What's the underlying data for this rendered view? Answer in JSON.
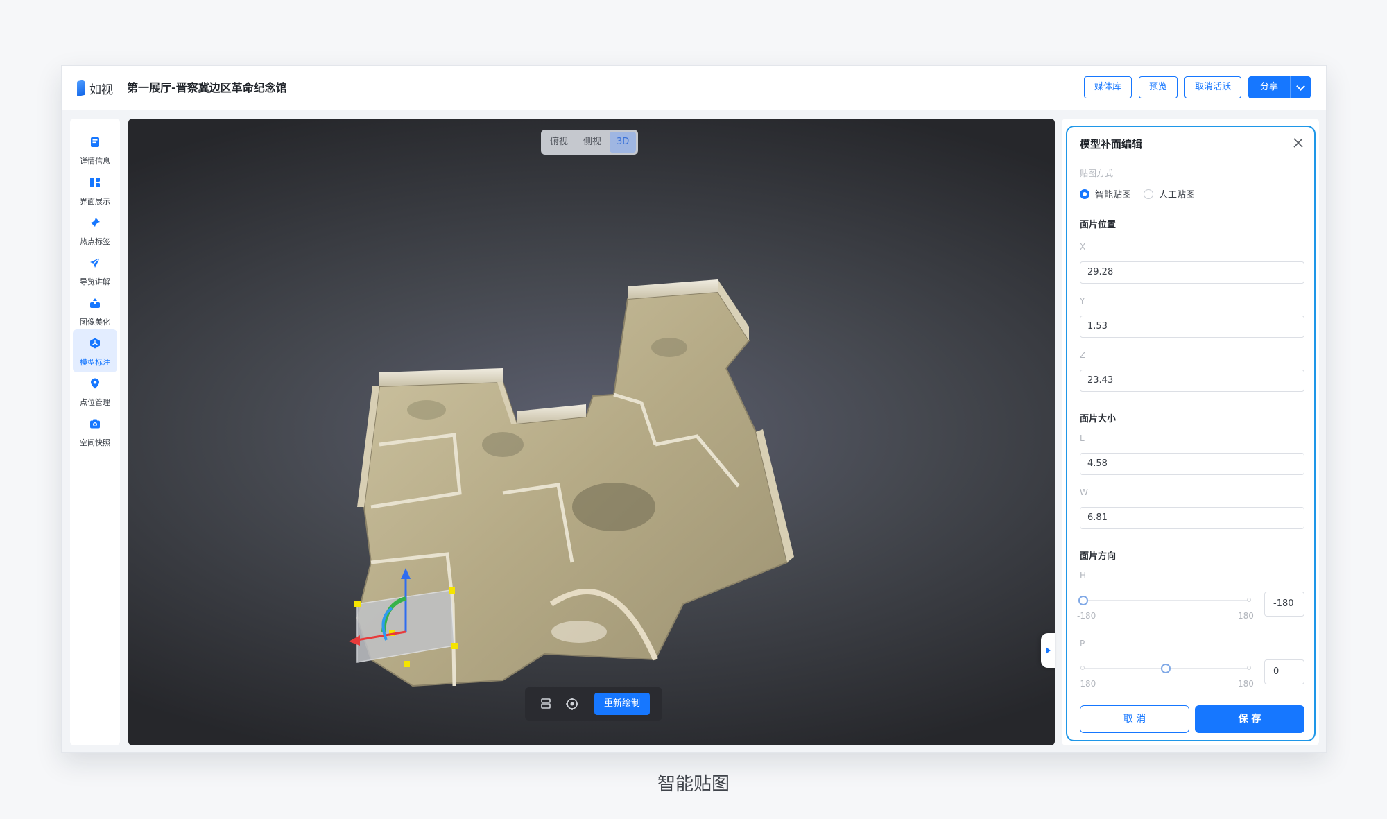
{
  "app": {
    "logo_text": "如视",
    "doc_title": "第一展厅-晋察冀边区革命纪念馆"
  },
  "header": {
    "buttons": [
      "媒体库",
      "预览",
      "取消活跃"
    ],
    "share_label": "分享"
  },
  "sidebar": {
    "items": [
      {
        "label": "详情信息",
        "icon": "detail-icon"
      },
      {
        "label": "界面展示",
        "icon": "layout-icon"
      },
      {
        "label": "热点标签",
        "icon": "pin-icon"
      },
      {
        "label": "导览讲解",
        "icon": "send-icon"
      },
      {
        "label": "图像美化",
        "icon": "beautify-icon"
      },
      {
        "label": "模型标注",
        "icon": "model-icon",
        "active": true
      },
      {
        "label": "点位管理",
        "icon": "location-icon"
      },
      {
        "label": "空间快照",
        "icon": "camera-icon"
      }
    ]
  },
  "viewport": {
    "view_modes": [
      "俯视",
      "侧视",
      "3D"
    ],
    "active_view": "3D",
    "redraw_label": "重新绘制"
  },
  "panel": {
    "title": "模型补面编辑",
    "texture_mode_label": "贴图方式",
    "texture_modes": [
      "智能贴图",
      "人工贴图"
    ],
    "texture_mode_selected": "智能贴图",
    "position_title": "面片位置",
    "x_label": "X",
    "x_value": "29.28",
    "y_label": "Y",
    "y_value": "1.53",
    "z_label": "Z",
    "z_value": "23.43",
    "size_title": "面片大小",
    "l_label": "L",
    "l_value": "4.58",
    "w_label": "W",
    "w_value": "6.81",
    "direction_title": "面片方向",
    "h_label": "H",
    "h_value": "-180",
    "h_min": "-180",
    "h_max": "180",
    "p_label": "P",
    "p_value": "0",
    "p_min": "-180",
    "p_max": "180",
    "cancel_label": "取 消",
    "save_label": "保 存"
  },
  "caption": "智能贴图",
  "colors": {
    "accent": "#1677ff",
    "panel_border": "#1f97e8"
  }
}
